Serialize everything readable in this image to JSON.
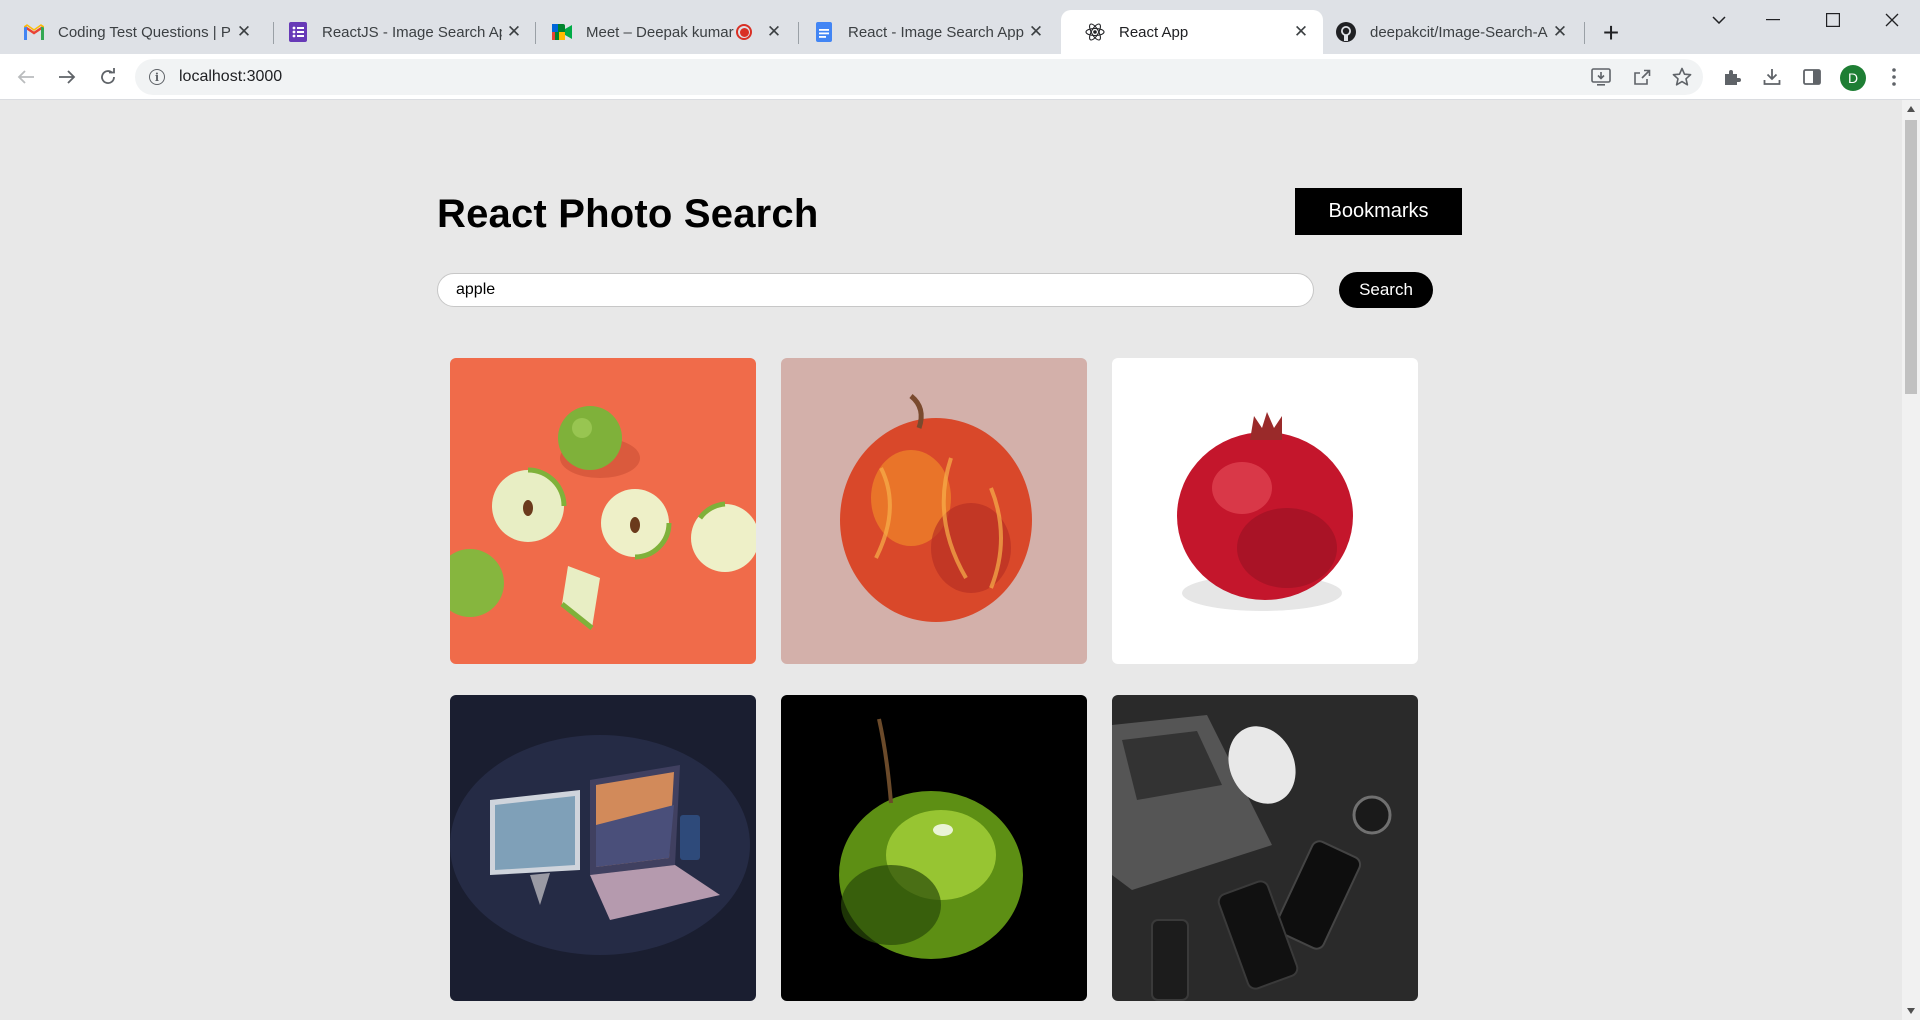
{
  "browser": {
    "tabs": [
      {
        "title": "Coding Test Questions | PRT",
        "icon": "gmail-icon"
      },
      {
        "title": "ReactJS - Image Search App",
        "icon": "forms-icon"
      },
      {
        "title": "Meet – Deepak kumar |",
        "icon": "meet-icon",
        "recording": true
      },
      {
        "title": "React - Image Search App -",
        "icon": "docs-icon"
      },
      {
        "title": "React App",
        "icon": "react-icon",
        "active": true
      },
      {
        "title": "deepakcit/Image-Search-Ap",
        "icon": "github-icon"
      }
    ],
    "url": "localhost:3000",
    "profile_initial": "D"
  },
  "app": {
    "title": "React Photo Search",
    "bookmarks_label": "Bookmarks",
    "search_value": "apple",
    "search_label": "Search"
  },
  "results": [
    {
      "subject": "sliced green apples on orange background"
    },
    {
      "subject": "painted red apple on pink background"
    },
    {
      "subject": "pomegranate on white background"
    },
    {
      "subject": "laptop and monitor devices on dark background"
    },
    {
      "subject": "green apple with water drops on black background"
    },
    {
      "subject": "laptop, mouse, phones and watch on dark desk"
    }
  ],
  "colors": {
    "page_bg": "#e8e8e8",
    "button_bg": "#000000",
    "chrome_tabstrip": "#dee1e6"
  }
}
